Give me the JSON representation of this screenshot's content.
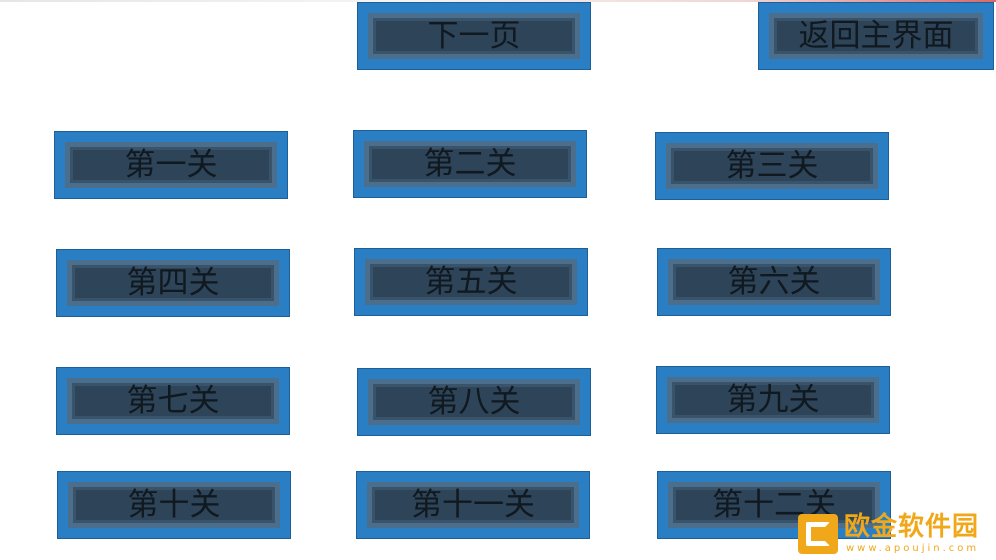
{
  "nav": {
    "next_page": "下一页",
    "back_to_main": "返回主界面"
  },
  "levels": [
    "第一关",
    "第二关",
    "第三关",
    "第四关",
    "第五关",
    "第六关",
    "第七关",
    "第八关",
    "第九关",
    "第十关",
    "第十一关",
    "第十二关"
  ],
  "watermark": {
    "text": "欧金软件园",
    "url": "www.apoujin.com"
  },
  "colors": {
    "button_outer": "#2a7fc4",
    "button_inner": "#2e4458",
    "button_bevel": "#4a6e8c",
    "label": "#101820",
    "watermark": "#f0a81a"
  }
}
